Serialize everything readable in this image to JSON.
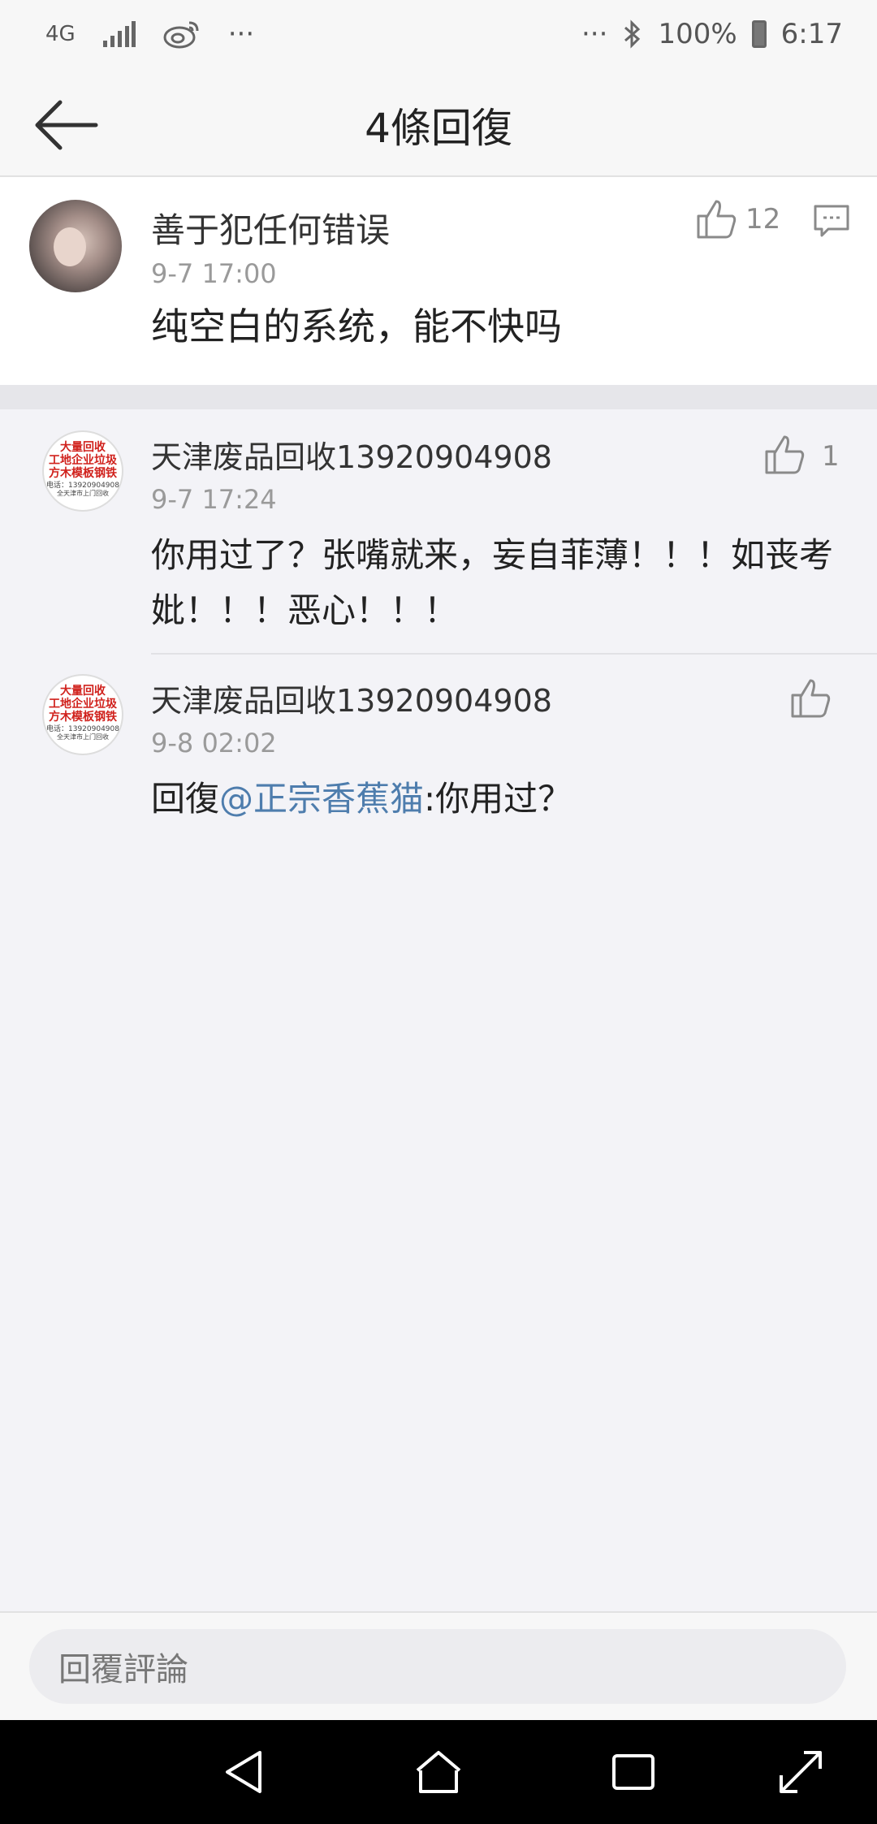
{
  "status_bar": {
    "network": "4G",
    "dots_left": "···",
    "dots_right": "···",
    "battery": "100%",
    "time": "6:17"
  },
  "nav": {
    "title": "4條回復"
  },
  "main_comment": {
    "name": "善于犯任何错误",
    "time": "9-7 17:00",
    "text": "纯空白的系统，能不快吗",
    "likes": "12"
  },
  "replies": [
    {
      "name": "天津废品回收13920904908",
      "time": "9-7 17:24",
      "text_line1": "你用过了？张嘴就来，妄自菲薄！！！如丧考",
      "text_line2": "妣！！！恶心！！！",
      "likes": "1"
    },
    {
      "name": "天津废品回收13920904908",
      "time": "9-8 02:02",
      "prefix": "回復",
      "mention": "@正宗香蕉猫",
      "suffix": ":你用过？",
      "likes": ""
    }
  ],
  "avatar_shop": {
    "line1": "大量回收",
    "line2": "工地企业垃圾",
    "line3": "方木模板钢铁",
    "line4": "电话：13920904908",
    "line5": "全天津市上门回收"
  },
  "input": {
    "placeholder": "回覆評論"
  },
  "colors": {
    "mention": "#4e7dad",
    "background": "#f3f3f7",
    "avatar_text_red": "#d0211c"
  }
}
